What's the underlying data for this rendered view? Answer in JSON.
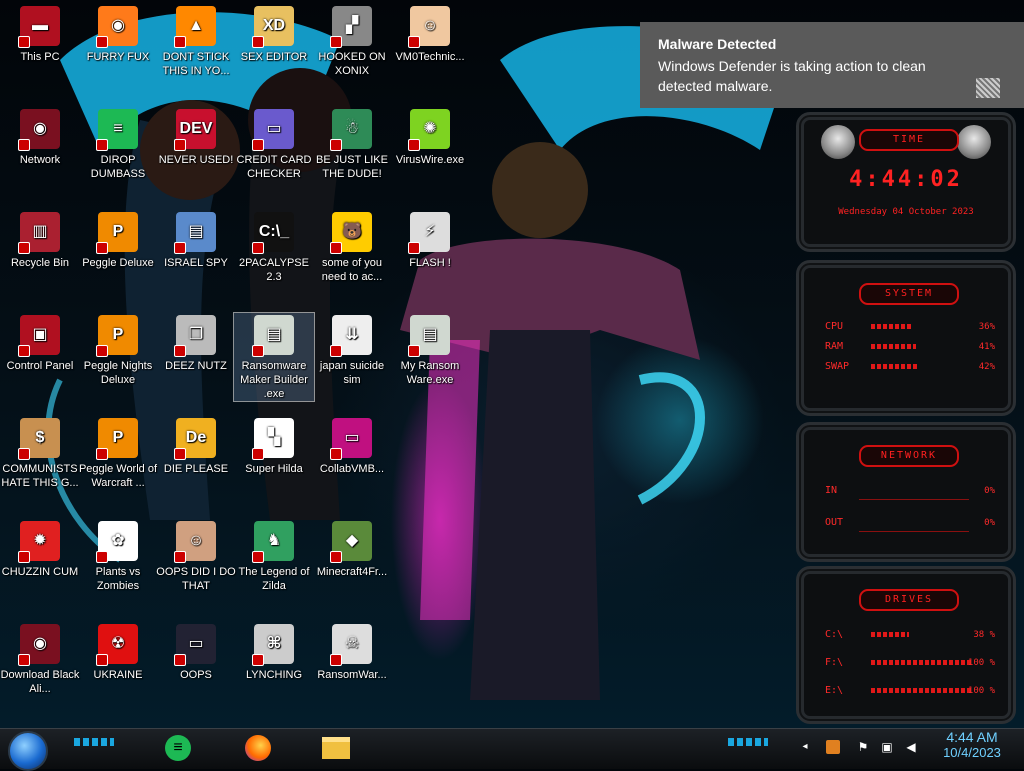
{
  "desktop": {
    "icons": [
      {
        "id": "this-pc",
        "label": "This PC",
        "col": 0,
        "row": 0,
        "color": "#b01020",
        "glyph": "▬",
        "icon": "computer-icon"
      },
      {
        "id": "furry-fux",
        "label": "FURRY FUX",
        "col": 1,
        "row": 0,
        "color": "#ff7a1a",
        "glyph": "◉",
        "icon": "firefox-icon"
      },
      {
        "id": "dont-stick",
        "label": "DONT STICK THIS IN YO...",
        "col": 2,
        "row": 0,
        "color": "#ff8800",
        "glyph": "▲",
        "icon": "vlc-cone-icon"
      },
      {
        "id": "sex-editor",
        "label": "SEX EDITOR",
        "col": 3,
        "row": 0,
        "color": "#e8c060",
        "glyph": "XD",
        "icon": "hex-editor-icon"
      },
      {
        "id": "hooked-on-xonix",
        "label": "HOOKED ON XONIX",
        "col": 4,
        "row": 0,
        "color": "#888888",
        "glyph": "▞",
        "icon": "xonix-game-icon"
      },
      {
        "id": "vm0technic",
        "label": "VM0Technic...",
        "col": 5,
        "row": 0,
        "color": "#f0c8a0",
        "glyph": "☺",
        "icon": "doctor-icon"
      },
      {
        "id": "network",
        "label": "Network",
        "col": 0,
        "row": 1,
        "color": "#7a1020",
        "glyph": "◉",
        "icon": "network-globe-icon"
      },
      {
        "id": "dirop-dumbass",
        "label": "DIROP DUMBASS",
        "col": 1,
        "row": 1,
        "color": "#1db954",
        "glyph": "≡",
        "icon": "spotify-icon"
      },
      {
        "id": "never-used",
        "label": "NEVER USED!",
        "col": 2,
        "row": 1,
        "color": "#c8102e",
        "glyph": "DEV",
        "icon": "dev-cpp-icon"
      },
      {
        "id": "credit-card-checker",
        "label": "CREDIT CARD CHECKER",
        "col": 3,
        "row": 1,
        "color": "#6a5acd",
        "glyph": "▭",
        "icon": "credit-card-icon"
      },
      {
        "id": "be-just-like",
        "label": "BE JUST LIKE THE DUDE!",
        "col": 4,
        "row": 1,
        "color": "#2e8b57",
        "glyph": "☃",
        "icon": "santa-icon"
      },
      {
        "id": "viruswire",
        "label": "VirusWire.exe",
        "col": 5,
        "row": 1,
        "color": "#7ed321",
        "glyph": "✺",
        "icon": "lime-icon"
      },
      {
        "id": "recycle-bin",
        "label": "Recycle Bin",
        "col": 0,
        "row": 2,
        "color": "#aa2030",
        "glyph": "▥",
        "icon": "recycle-bin-icon"
      },
      {
        "id": "peggle-deluxe",
        "label": "Peggle Deluxe",
        "col": 1,
        "row": 2,
        "color": "#f08a00",
        "glyph": "P",
        "icon": "peggle-icon"
      },
      {
        "id": "israel-spy",
        "label": "ISRAEL SPY",
        "col": 2,
        "row": 2,
        "color": "#5a8acb",
        "glyph": "▤",
        "icon": "spy-icon"
      },
      {
        "id": "2pacalypse",
        "label": "2PACALYPSE 2.3",
        "col": 3,
        "row": 2,
        "color": "#111111",
        "glyph": "C:\\_",
        "icon": "terminal-icon"
      },
      {
        "id": "some-of-you",
        "label": "some of you need to ac...",
        "col": 4,
        "row": 2,
        "color": "#ffcc00",
        "glyph": "🐻",
        "icon": "bear-icon"
      },
      {
        "id": "flash",
        "label": "FLASH !",
        "col": 5,
        "row": 2,
        "color": "#dddddd",
        "glyph": "⚡",
        "icon": "flash-icon"
      },
      {
        "id": "control-panel",
        "label": "Control Panel",
        "col": 0,
        "row": 3,
        "color": "#b01020",
        "glyph": "▣",
        "icon": "control-panel-icon"
      },
      {
        "id": "peggle-nights",
        "label": "Peggle Nights Deluxe",
        "col": 1,
        "row": 3,
        "color": "#f08a00",
        "glyph": "P",
        "icon": "peggle-icon"
      },
      {
        "id": "deez-nutz",
        "label": "DEEZ NUTZ",
        "col": 2,
        "row": 3,
        "color": "#bbbbbb",
        "glyph": "❐",
        "icon": "window-stack-icon"
      },
      {
        "id": "ransomware-maker",
        "label": "Ransomware Maker Builder .exe",
        "col": 3,
        "row": 3,
        "color": "#d0d8d0",
        "glyph": "▤",
        "icon": "exe-window-icon",
        "selected": true
      },
      {
        "id": "japan-suicide",
        "label": "japan suicide sim",
        "col": 4,
        "row": 3,
        "color": "#eeeeee",
        "glyph": "⇊",
        "icon": "document-icon"
      },
      {
        "id": "my-ransomware",
        "label": "My Ransom Ware.exe",
        "col": 5,
        "row": 3,
        "color": "#d0d8d0",
        "glyph": "▤",
        "icon": "exe-window-icon"
      },
      {
        "id": "communists",
        "label": "COMMUNISTS HATE THIS G...",
        "col": 0,
        "row": 4,
        "color": "#c89050",
        "glyph": "$",
        "icon": "money-bag-icon"
      },
      {
        "id": "peggle-wow",
        "label": "Peggle World of Warcraft ...",
        "col": 1,
        "row": 4,
        "color": "#f08a00",
        "glyph": "P",
        "icon": "peggle-icon"
      },
      {
        "id": "die-please",
        "label": "DIE PLEASE",
        "col": 2,
        "row": 4,
        "color": "#f0b020",
        "glyph": "De",
        "icon": "de-icon"
      },
      {
        "id": "super-hilda",
        "label": "Super Hilda",
        "col": 3,
        "row": 4,
        "color": "#ffffff",
        "glyph": "▚",
        "icon": "pixel-art-icon"
      },
      {
        "id": "collabvmb",
        "label": "CollabVMB...",
        "col": 4,
        "row": 4,
        "color": "#c01080",
        "glyph": "▭",
        "icon": "monitor-icon"
      },
      {
        "id": "chuzzin-cum",
        "label": "CHUZZIN CUM",
        "col": 0,
        "row": 5,
        "color": "#e02020",
        "glyph": "✹",
        "icon": "chuzzle-icon"
      },
      {
        "id": "plants-vs-zombies",
        "label": "Plants vs Zombies",
        "col": 1,
        "row": 5,
        "color": "#ffffff",
        "glyph": "✿",
        "icon": "flower-icon"
      },
      {
        "id": "oops-did-i",
        "label": "OOPS DID I DO THAT",
        "col": 2,
        "row": 5,
        "color": "#d0a080",
        "glyph": "☺",
        "icon": "portrait-icon"
      },
      {
        "id": "legend-of-zilda",
        "label": "The Legend of Zilda",
        "col": 3,
        "row": 5,
        "color": "#30a060",
        "glyph": "♞",
        "icon": "link-sprite-icon"
      },
      {
        "id": "minecraft4fr",
        "label": "Minecraft4Fr...",
        "col": 4,
        "row": 5,
        "color": "#5a8a3a",
        "glyph": "◆",
        "icon": "grass-block-icon"
      },
      {
        "id": "download-black",
        "label": "Download Black Ali...",
        "col": 0,
        "row": 6,
        "color": "#7a1020",
        "glyph": "◉",
        "icon": "alien-globe-icon"
      },
      {
        "id": "ukraine",
        "label": "UKRAINE",
        "col": 1,
        "row": 6,
        "color": "#e01010",
        "glyph": "☢",
        "icon": "radiation-icon"
      },
      {
        "id": "oops",
        "label": "OOPS",
        "col": 2,
        "row": 6,
        "color": "#222233",
        "glyph": "▭",
        "icon": "monitor-icon"
      },
      {
        "id": "lynching",
        "label": "LYNCHING",
        "col": 3,
        "row": 6,
        "color": "#cccccc",
        "glyph": "⌘",
        "icon": "rope-icon"
      },
      {
        "id": "ransomwar",
        "label": "RansomWar...",
        "col": 4,
        "row": 6,
        "color": "#dddddd",
        "glyph": "☠",
        "icon": "skull-icon"
      }
    ]
  },
  "toast": {
    "title": "Malware Detected",
    "body": "Windows Defender is taking action to clean detected malware.",
    "icon": "defender-icon"
  },
  "gadgets": {
    "time": {
      "title": "TIME",
      "clock": "4:44:02",
      "date": "Wednesday 04 October 2023"
    },
    "system": {
      "title": "SYSTEM",
      "rows": [
        {
          "label": "CPU",
          "value": "36%",
          "fraction": 0.36
        },
        {
          "label": "RAM",
          "value": "41%",
          "fraction": 0.41
        },
        {
          "label": "SWAP",
          "value": "42%",
          "fraction": 0.42
        }
      ]
    },
    "network": {
      "title": "NETWORK",
      "rows": [
        {
          "label": "IN",
          "value": "0%"
        },
        {
          "label": "OUT",
          "value": "0%"
        }
      ]
    },
    "drives": {
      "title": "DRIVES",
      "rows": [
        {
          "label": "C:\\",
          "value": "38 %",
          "fraction": 0.38
        },
        {
          "label": "F:\\",
          "value": "100 %",
          "fraction": 1.0
        },
        {
          "label": "E:\\",
          "value": "100 %",
          "fraction": 1.0
        }
      ]
    }
  },
  "taskbar": {
    "apps": [
      {
        "id": "spotify",
        "icon": "spotify-icon",
        "color": "#1db954"
      },
      {
        "id": "firefox",
        "icon": "firefox-icon",
        "color": "#ff7a1a"
      },
      {
        "id": "explorer",
        "icon": "file-explorer-icon",
        "color": "#f0c040"
      }
    ],
    "tray": [
      "flag-icon",
      "network-icon",
      "volume-icon"
    ],
    "clock": {
      "time": "4:44 AM",
      "date": "10/4/2023"
    }
  }
}
